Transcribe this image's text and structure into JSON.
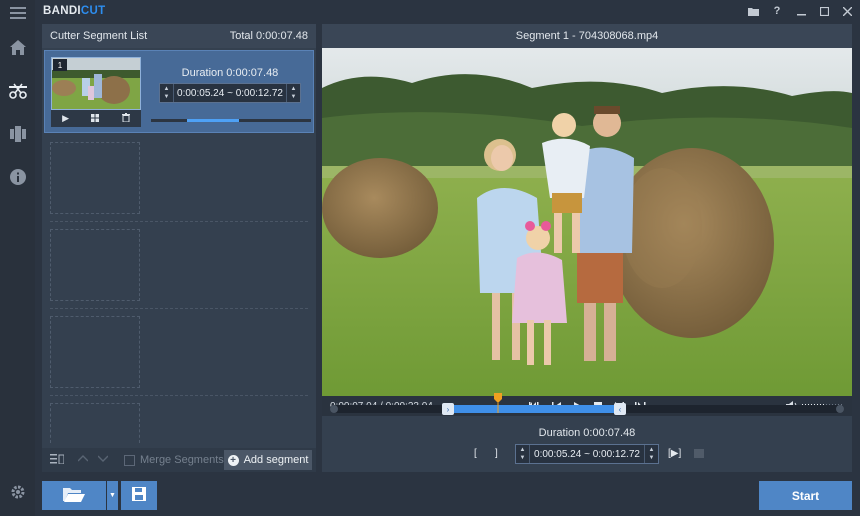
{
  "app": {
    "logo_main": "BANDI",
    "logo_accent": "CUT"
  },
  "titlebar": {
    "icons": [
      "folder-icon",
      "help-icon",
      "minimize-icon",
      "maximize-icon",
      "close-icon"
    ],
    "help_glyph": "?"
  },
  "rail": {
    "icons": [
      "menu-icon",
      "home-icon",
      "cutter-icon",
      "video-library-icon",
      "info-icon",
      "settings-icon"
    ]
  },
  "segment_list": {
    "title": "Cutter Segment List",
    "total": "Total 0:00:07.48",
    "segments": [
      {
        "number": "1",
        "duration": "Duration 0:00:07.48",
        "range": "0:00:05.24 ~ 0:00:12.72"
      }
    ],
    "footer": {
      "merge_label": "Merge Segments",
      "add_label": "Add segment"
    }
  },
  "preview": {
    "title": "Segment 1 - 704308068.mp4",
    "time": "0:00:07.04 / 0:00:23.04",
    "duration": "Duration 0:00:07.48",
    "range": "0:00:05.24 ~ 0:00:12.72",
    "bracket_in": "[",
    "bracket_out": "]",
    "play_segment": "[▶]"
  },
  "bottom": {
    "start_label": "Start"
  },
  "colors": {
    "accent": "#4f86c6",
    "logo_accent": "#2d8ef0",
    "selection": "#3f8fe8",
    "playhead": "#f0a020"
  }
}
